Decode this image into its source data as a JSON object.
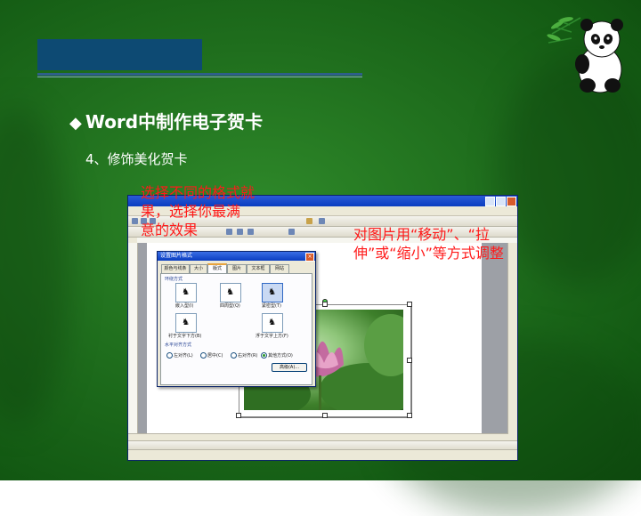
{
  "slide": {
    "title_bullet": "◆",
    "title": "Word中制作电子贺卡",
    "subtitle": "4、修饰美化贺卡",
    "caption_left": [
      "选择不同的格式就",
      "果，选择你最满",
      "意的效果"
    ],
    "caption_right": [
      "对图片用“移动”、“拉",
      "伸”或“缩小”等方式调整"
    ]
  },
  "dialog": {
    "title": "设置图片格式",
    "tabs": [
      "颜色与线条",
      "大小",
      "版式",
      "图片",
      "文本框",
      "网站"
    ],
    "active_tab": "版式",
    "wrap_section": "环绕方式",
    "wrap_options": [
      "嵌入型(I)",
      "四周型(Q)",
      "紧密型(T)",
      "衬于文字下方(B)",
      "浮于文字上方(F)"
    ],
    "selected_wrap": "紧密型(T)",
    "align_section": "水平对齐方式",
    "align_options": [
      "左对齐(L)",
      "居中(C)",
      "右对齐(R)",
      "其他方式(O)"
    ],
    "selected_align": "其他方式(O)",
    "advanced_button": "高级(A)..."
  },
  "icons": [
    "panda-icon",
    "dog-icon",
    "window-close-icon"
  ],
  "colors": {
    "title_text": "#ffffff",
    "caption_text": "#ff1a1a",
    "header_bar": "#0d4a73"
  }
}
